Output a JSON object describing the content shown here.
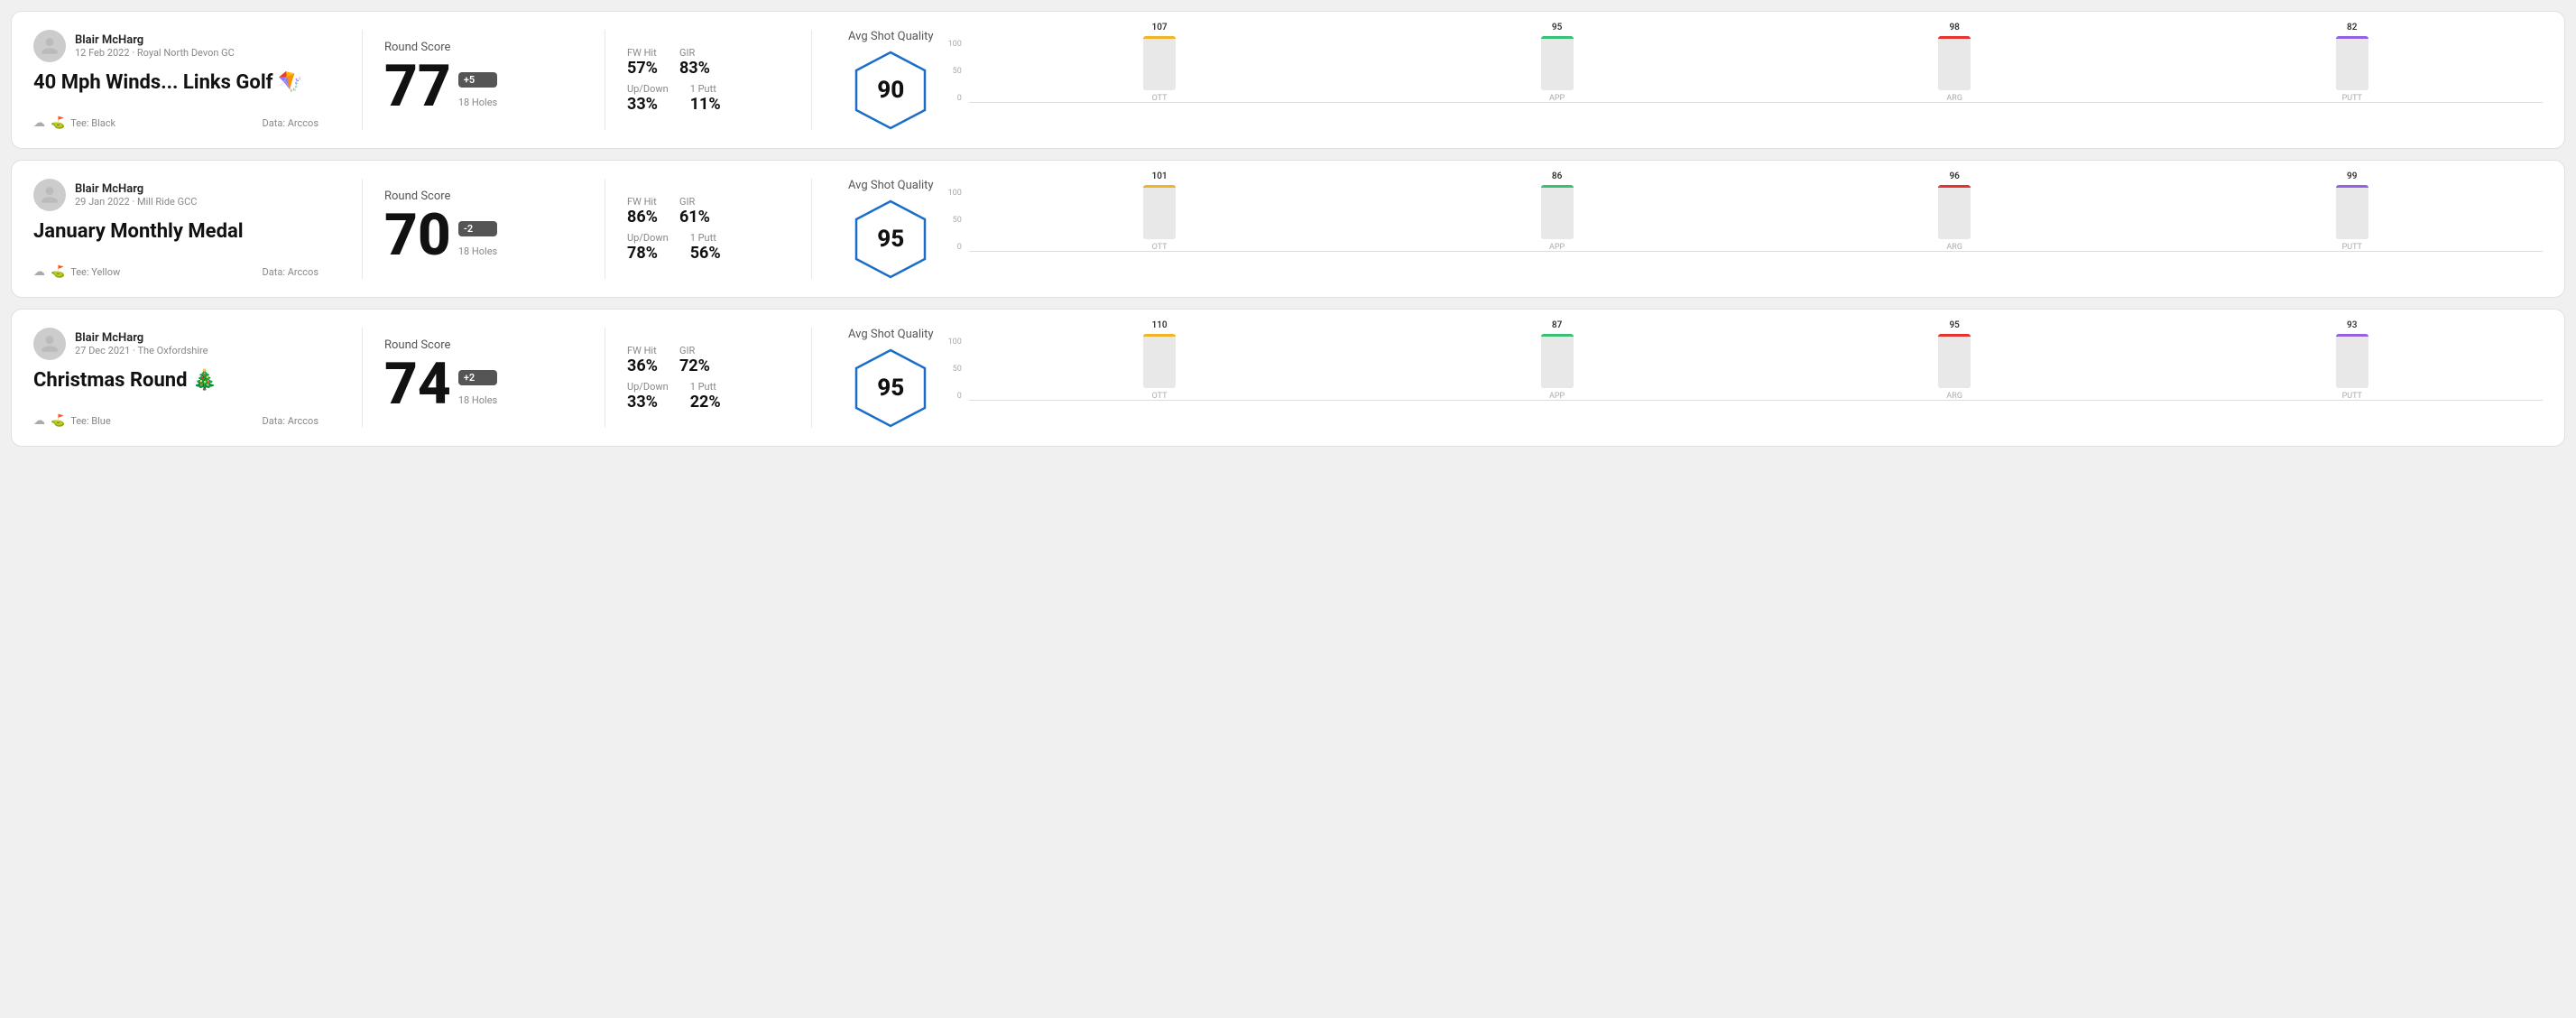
{
  "rounds": [
    {
      "id": "round-1",
      "user": {
        "name": "Blair McHarg",
        "date": "12 Feb 2022",
        "course": "Royal North Devon GC"
      },
      "title": "40 Mph Winds... Links Golf 🪁",
      "tee": "Black",
      "data_source": "Data: Arccos",
      "score": "77",
      "score_diff": "+5",
      "holes": "18 Holes",
      "fw_hit": "57%",
      "gir": "83%",
      "up_down": "33%",
      "one_putt": "11%",
      "avg_quality": "90",
      "chart": {
        "ott": {
          "label": "OTT",
          "value": 107,
          "color": "#f0b429"
        },
        "app": {
          "label": "APP",
          "value": 95,
          "color": "#38c172"
        },
        "arg": {
          "label": "ARG",
          "value": 98,
          "color": "#e3342f"
        },
        "putt": {
          "label": "PUTT",
          "value": 82,
          "color": "#9561e2"
        }
      }
    },
    {
      "id": "round-2",
      "user": {
        "name": "Blair McHarg",
        "date": "29 Jan 2022",
        "course": "Mill Ride GCC"
      },
      "title": "January Monthly Medal",
      "tee": "Yellow",
      "data_source": "Data: Arccos",
      "score": "70",
      "score_diff": "-2",
      "holes": "18 Holes",
      "fw_hit": "86%",
      "gir": "61%",
      "up_down": "78%",
      "one_putt": "56%",
      "avg_quality": "95",
      "chart": {
        "ott": {
          "label": "OTT",
          "value": 101,
          "color": "#f0b429"
        },
        "app": {
          "label": "APP",
          "value": 86,
          "color": "#38c172"
        },
        "arg": {
          "label": "ARG",
          "value": 96,
          "color": "#e3342f"
        },
        "putt": {
          "label": "PUTT",
          "value": 99,
          "color": "#9561e2"
        }
      }
    },
    {
      "id": "round-3",
      "user": {
        "name": "Blair McHarg",
        "date": "27 Dec 2021",
        "course": "The Oxfordshire"
      },
      "title": "Christmas Round 🎄",
      "tee": "Blue",
      "data_source": "Data: Arccos",
      "score": "74",
      "score_diff": "+2",
      "holes": "18 Holes",
      "fw_hit": "36%",
      "gir": "72%",
      "up_down": "33%",
      "one_putt": "22%",
      "avg_quality": "95",
      "chart": {
        "ott": {
          "label": "OTT",
          "value": 110,
          "color": "#f0b429"
        },
        "app": {
          "label": "APP",
          "value": 87,
          "color": "#38c172"
        },
        "arg": {
          "label": "ARG",
          "value": 95,
          "color": "#e3342f"
        },
        "putt": {
          "label": "PUTT",
          "value": 93,
          "color": "#9561e2"
        }
      }
    }
  ],
  "chart_y_labels": [
    "100",
    "50",
    "0"
  ],
  "labels": {
    "round_score": "Round Score",
    "fw_hit": "FW Hit",
    "gir": "GIR",
    "up_down": "Up/Down",
    "one_putt": "1 Putt",
    "avg_quality": "Avg Shot Quality",
    "tee_prefix": "Tee:",
    "data_arccos": "Data: Arccos"
  }
}
